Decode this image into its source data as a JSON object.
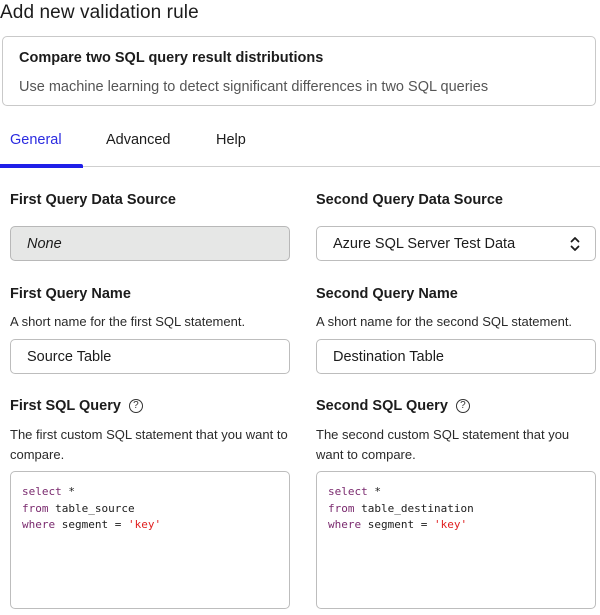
{
  "page": {
    "title": "Add new validation rule"
  },
  "rule_card": {
    "title": "Compare two SQL query result distributions",
    "description": "Use machine learning to detect significant differences in two SQL queries"
  },
  "tabs": [
    {
      "label": "General",
      "active": true
    },
    {
      "label": "Advanced",
      "active": false
    },
    {
      "label": "Help",
      "active": false
    }
  ],
  "colors": {
    "accent": "#1f1fe8",
    "keyword": "#7a2a6e",
    "string": "#e01e1e"
  },
  "first": {
    "data_source_label": "First Query Data Source",
    "data_source_value": "None",
    "name_label": "First Query Name",
    "name_help": "A short name for the first SQL statement.",
    "name_value": "Source Table",
    "sql_label": "First SQL Query",
    "sql_help": "The first custom SQL statement that you want to compare.",
    "sql": {
      "line1_kw": "select",
      "line1_rest": " *",
      "line2_kw": "from",
      "line2_rest": " table_source",
      "line3_kw": "where",
      "line3_rest": " segment = ",
      "line3_str": "'key'"
    }
  },
  "second": {
    "data_source_label": "Second Query Data Source",
    "data_source_value": "Azure SQL Server Test Data",
    "name_label": "Second Query Name",
    "name_help": "A short name for the second SQL statement.",
    "name_value": "Destination Table",
    "sql_label": "Second SQL Query",
    "sql_help": "The second custom SQL statement that you want to compare.",
    "sql": {
      "line1_kw": "select",
      "line1_rest": " *",
      "line2_kw": "from",
      "line2_rest": " table_destination",
      "line3_kw": "where",
      "line3_rest": " segment = ",
      "line3_str": "'key'"
    }
  },
  "icons": {
    "help": "?",
    "select_arrows": "chevron-up-down-icon"
  }
}
